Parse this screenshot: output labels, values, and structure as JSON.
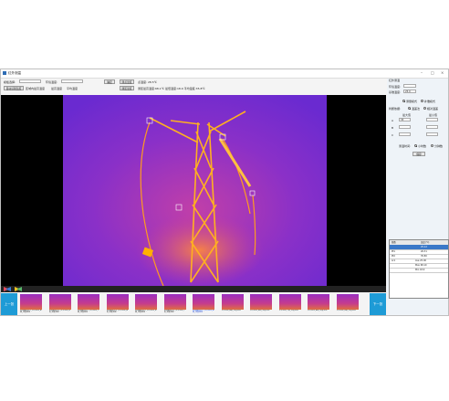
{
  "window": {
    "title": "红外测温"
  },
  "toolbar": {
    "model_label": "模板选择:",
    "model_value": "",
    "env_temp_label": "环境温度:",
    "env_temp_value": "",
    "confirm_button": "确定",
    "measure_button": "测点温度",
    "point_temp_text": "点温度: 28.5℃",
    "auto_button": "自动识别温度",
    "manual_button": "区域内最高温度",
    "max_label": "最高温度",
    "avg_label": "平均温度",
    "area_button": "测区温度",
    "area_result": "测区最高温度:68.1℃  最低温度:18.9  平均温度:35.8℃"
  },
  "right_panel": {
    "title": "红外测温",
    "env_temp_label": "环境温度:",
    "env_temp_value": "",
    "ref_temp_label": "基准温度:",
    "ref_temp_value": "25.0",
    "radio_a": "测量模式",
    "radio_b": "补偿模式",
    "mode_label": "判断依据:",
    "mode_a": "温差法",
    "mode_b": "相对温差",
    "col_max": "最大值",
    "col_min": "最小值",
    "row_a": "A",
    "row_b": "B",
    "row_c": "C",
    "a_max": "35",
    "a_min": "",
    "b_max": "",
    "b_min": "",
    "c_max": "",
    "c_min": "",
    "time_label": "测温时间:",
    "time_a": "小时数",
    "time_b": "分钟数",
    "save_button": "保存",
    "table_header": [
      "参数",
      "温度(℃)"
    ],
    "table_rows": [
      [
        "",
        "25.12"
      ],
      [
        "Pt1",
        "26.31"
      ],
      [
        "Pt2",
        "35.80"
      ],
      [
        "Ar1",
        "Ave 25.90"
      ],
      [
        "",
        "Max 68.10"
      ],
      [
        "",
        "Min 18.9"
      ]
    ]
  },
  "strip": {
    "prev_button": "上一张",
    "next_button": "下一张",
    "thumbs": [
      {
        "caption": "某线路某塔号_红外测温_A相_温度测温"
      },
      {
        "caption": "某线路某塔号_红外测温_B相_温度测温"
      },
      {
        "caption": "某线路某塔号_红外测温_C相_温度测温"
      },
      {
        "caption": "某线路某塔号_红外测温_A相_温度测温"
      },
      {
        "caption": "某线路某塔号_红外测温_B相_温度测温"
      },
      {
        "caption": "某线路某塔号_红外测温_C相_温度测温"
      },
      {
        "caption": "某线路某塔号_红外测温_A相_温度测温"
      },
      {
        "caption": "红外测温_A相_温度测温"
      },
      {
        "caption": "红外测温_B相_温度测温"
      },
      {
        "caption": "红外测温_C相_温度测温"
      },
      {
        "caption": "红外测温_A相_温度测温"
      },
      {
        "caption": "红外测温_B相_温度测温"
      }
    ],
    "active_index": 6
  },
  "colors": {
    "accent": "#1e9bd6",
    "thermal_bg": "#7b2bd1",
    "thermal_hot": "#ffb000"
  }
}
